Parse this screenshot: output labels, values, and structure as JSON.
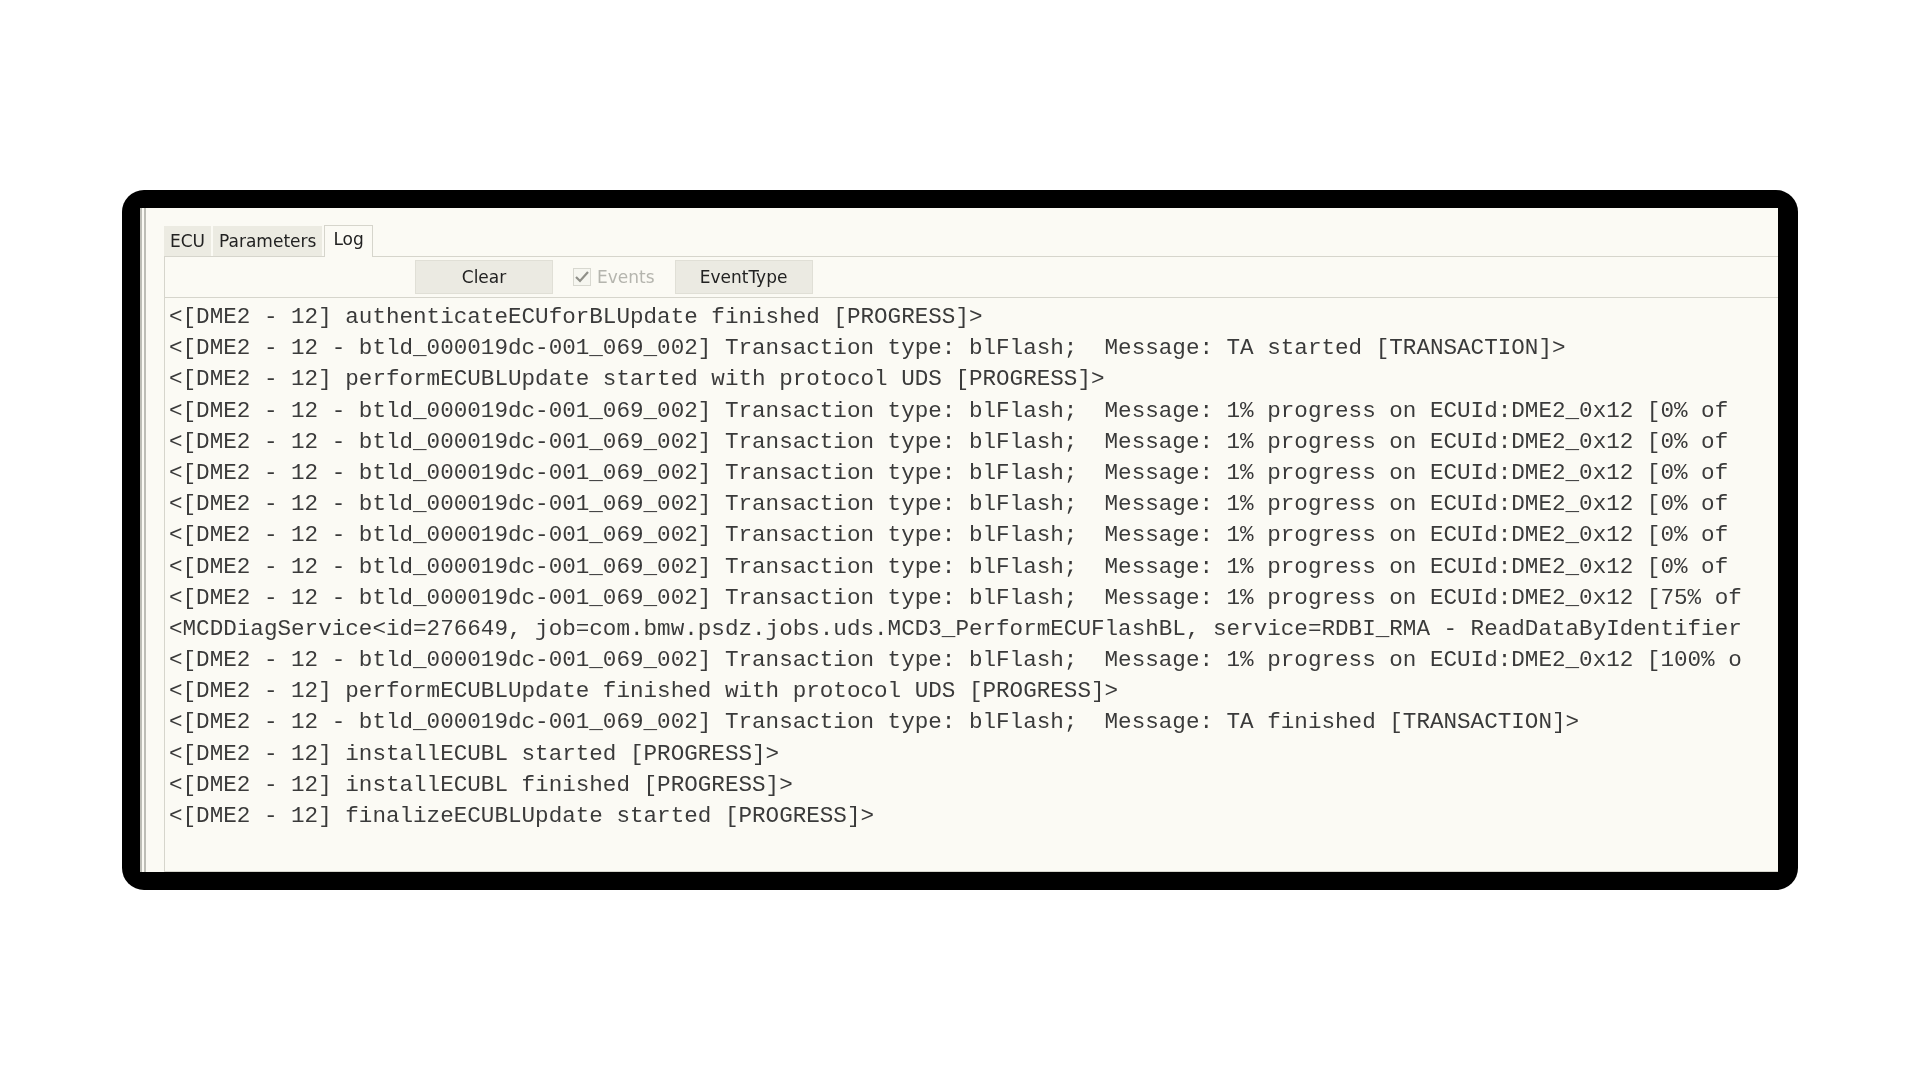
{
  "tabs": [
    {
      "label": "ECU",
      "selected": false
    },
    {
      "label": "Parameters",
      "selected": false
    },
    {
      "label": "Log",
      "selected": true
    }
  ],
  "toolbar": {
    "clear_button": "Clear",
    "events_checkbox": {
      "label": "Events",
      "checked": true,
      "disabled": true
    },
    "eventtype_button": "EventType"
  },
  "log_lines": [
    "<[DME2 - 12] authenticateECUforBLUpdate finished [PROGRESS]>",
    "<[DME2 - 12 - btld_000019dc-001_069_002] Transaction type: blFlash;  Message: TA started [TRANSACTION]>",
    "<[DME2 - 12] performECUBLUpdate started with protocol UDS [PROGRESS]>",
    "<[DME2 - 12 - btld_000019dc-001_069_002] Transaction type: blFlash;  Message: 1% progress on ECUId:DME2_0x12 [0% of",
    "<[DME2 - 12 - btld_000019dc-001_069_002] Transaction type: blFlash;  Message: 1% progress on ECUId:DME2_0x12 [0% of",
    "<[DME2 - 12 - btld_000019dc-001_069_002] Transaction type: blFlash;  Message: 1% progress on ECUId:DME2_0x12 [0% of",
    "<[DME2 - 12 - btld_000019dc-001_069_002] Transaction type: blFlash;  Message: 1% progress on ECUId:DME2_0x12 [0% of",
    "<[DME2 - 12 - btld_000019dc-001_069_002] Transaction type: blFlash;  Message: 1% progress on ECUId:DME2_0x12 [0% of",
    "<[DME2 - 12 - btld_000019dc-001_069_002] Transaction type: blFlash;  Message: 1% progress on ECUId:DME2_0x12 [0% of",
    "<[DME2 - 12 - btld_000019dc-001_069_002] Transaction type: blFlash;  Message: 1% progress on ECUId:DME2_0x12 [75% of",
    "<MCDDiagService<id=276649, job=com.bmw.psdz.jobs.uds.MCD3_PerformECUFlashBL, service=RDBI_RMA - ReadDataByIdentifier",
    "<[DME2 - 12 - btld_000019dc-001_069_002] Transaction type: blFlash;  Message: 1% progress on ECUId:DME2_0x12 [100% o",
    "<[DME2 - 12] performECUBLUpdate finished with protocol UDS [PROGRESS]>",
    "<[DME2 - 12 - btld_000019dc-001_069_002] Transaction type: blFlash;  Message: TA finished [TRANSACTION]>",
    "<[DME2 - 12] installECUBL started [PROGRESS]>",
    "<[DME2 - 12] installECUBL finished [PROGRESS]>",
    "<[DME2 - 12] finalizeECUBLUpdate started [PROGRESS]>"
  ]
}
